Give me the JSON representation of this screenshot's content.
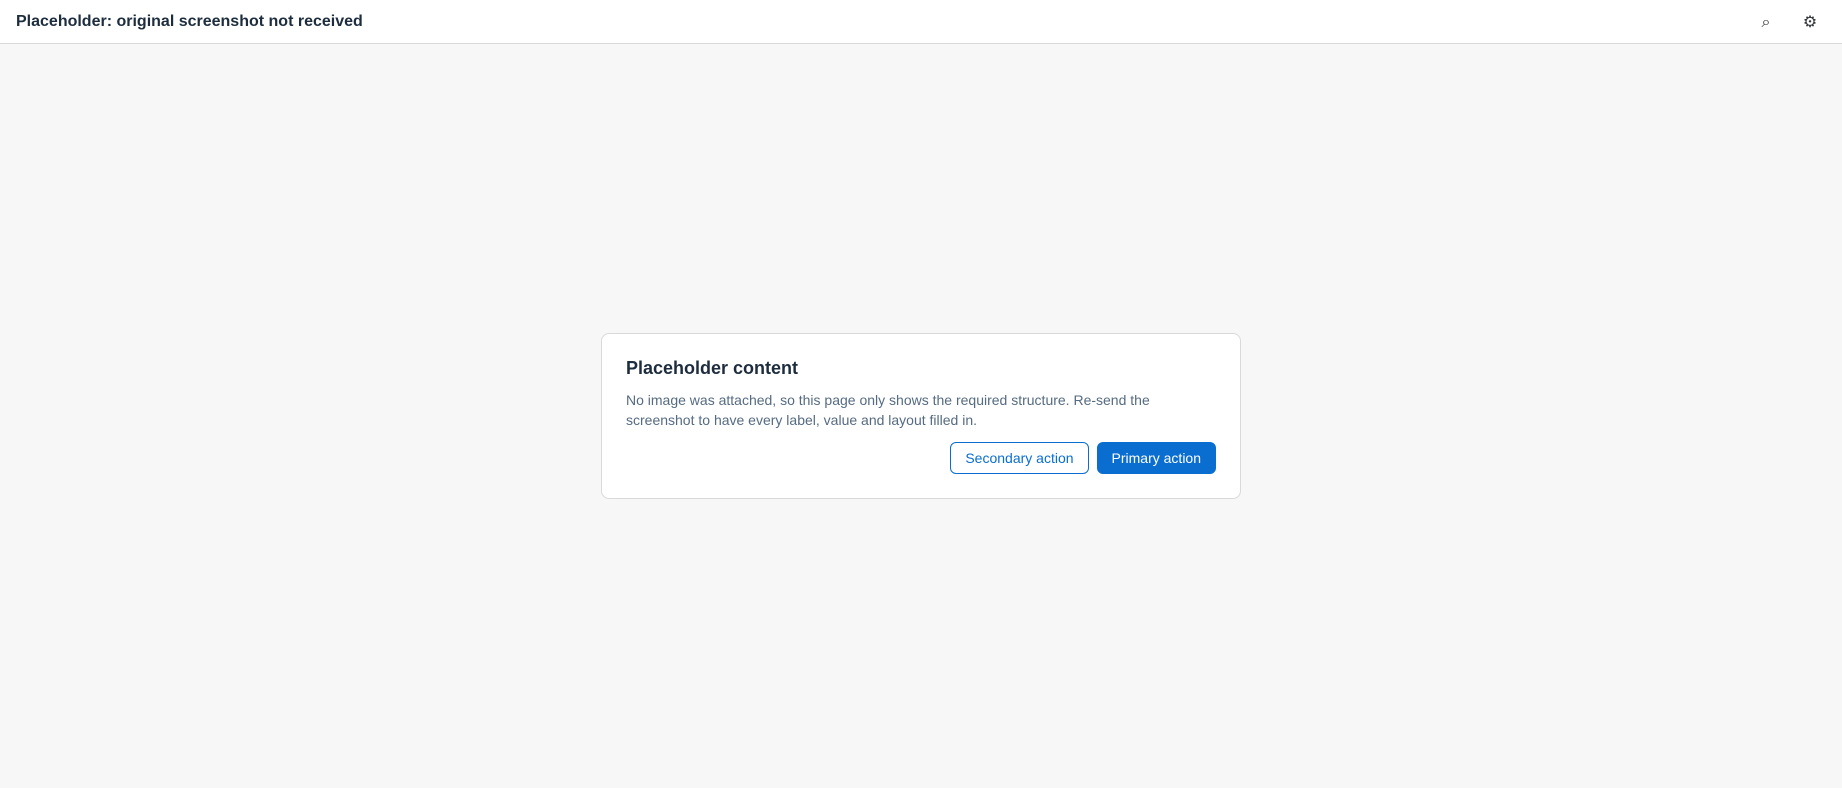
{
  "titlebar": {
    "title": "Placeholder: original screenshot not received",
    "search_icon": "search-icon",
    "settings_icon": "gear-icon"
  },
  "main": {
    "heading": "Placeholder content",
    "text": "No image was attached, so this page only shows the required structure. Re-send the screenshot to have every label, value and layout filled in.",
    "primary_label": "Primary action",
    "secondary_label": "Secondary action"
  }
}
